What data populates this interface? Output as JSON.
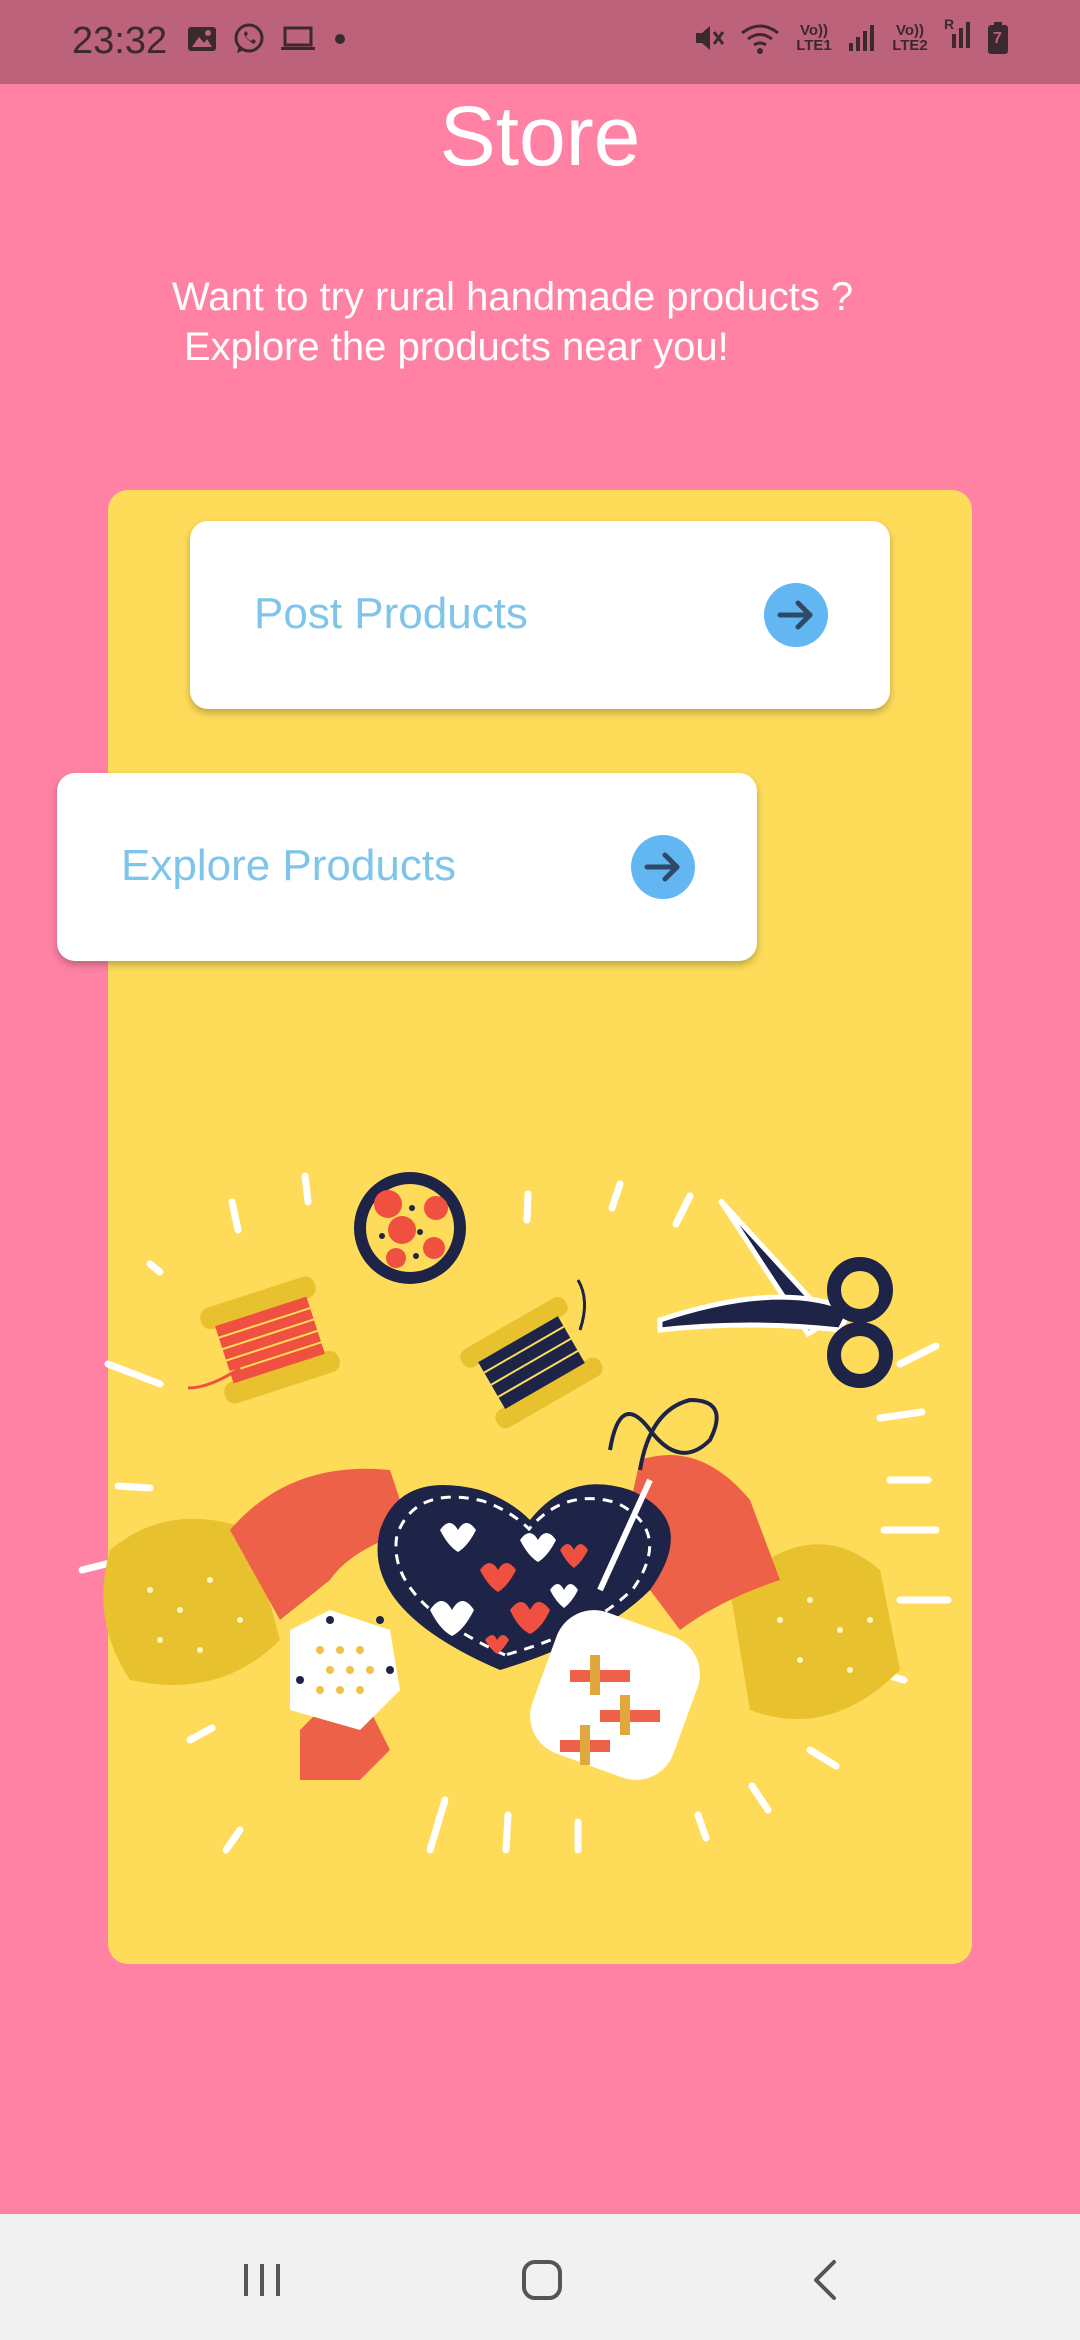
{
  "status_bar": {
    "time": "23:32",
    "left_icons": [
      "image-icon",
      "whatsapp-icon",
      "laptop-icon",
      "dot-icon"
    ],
    "sim1_label": "Vo)) LTE1",
    "sim2_label": "Vo)) LTE2",
    "roaming_indicator": "R",
    "battery_level_label": "7"
  },
  "page": {
    "title": "Store",
    "subtitle_line1": "Want to try rural handmade products ?",
    "subtitle_line2": "Explore the products near you!"
  },
  "actions": {
    "post_label": "Post Products",
    "explore_label": "Explore Products"
  },
  "colors": {
    "background": "#ff82a5",
    "panel": "#fedc5a",
    "label": "#7ec5ec",
    "arrow_button": "#62b6f1",
    "arrow": "#2e4a66"
  },
  "illustration": {
    "description_icon": "handcraft-illustration"
  },
  "nav": {
    "buttons": [
      "recent-apps",
      "home",
      "back"
    ]
  }
}
